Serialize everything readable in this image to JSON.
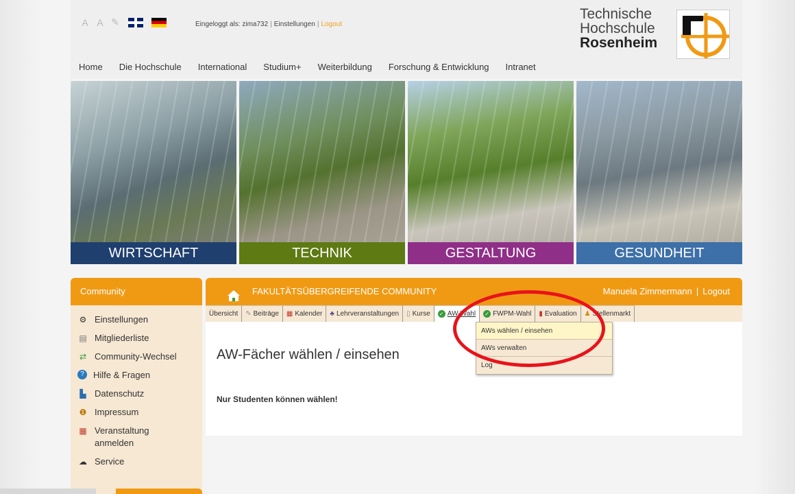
{
  "header": {
    "tool_icons": [
      "zoom-out-icon",
      "zoom-in-icon",
      "pin-icon"
    ],
    "login_prefix": "Eingeloggt als: zima732",
    "settings_link": "Einstellungen",
    "logout_link": "Logout",
    "logo_line1": "Technische",
    "logo_line2": "Hochschule",
    "logo_line3": "Rosenheim",
    "nav": [
      "Home",
      "Die Hochschule",
      "International",
      "Studium+",
      "Weiterbildung",
      "Forschung & Entwicklung",
      "Intranet"
    ]
  },
  "banner": {
    "panels": [
      {
        "label": "WIRTSCHAFT",
        "color": "#1f3f6e"
      },
      {
        "label": "TECHNIK",
        "color": "#5e7a12"
      },
      {
        "label": "GESTALTUNG",
        "color": "#8f2f87"
      },
      {
        "label": "GESUNDHEIT",
        "color": "#3d6fa8"
      }
    ]
  },
  "sidebar": {
    "title": "Community",
    "items": [
      {
        "label": "Einstellungen",
        "icon": "gear-icon"
      },
      {
        "label": "Mitgliederliste",
        "icon": "list-icon"
      },
      {
        "label": "Community-Wechsel",
        "icon": "switch-icon"
      },
      {
        "label": "Hilfe & Fragen",
        "icon": "help-icon"
      },
      {
        "label": "Datenschutz",
        "icon": "privacy-icon"
      },
      {
        "label": "Impressum",
        "icon": "info-icon"
      },
      {
        "label": "Veranstaltung anmelden",
        "icon": "calendar-icon"
      },
      {
        "label": "Service",
        "icon": "service-icon"
      }
    ]
  },
  "content": {
    "community_title": "FAKULTÄTSÜBERGREIFENDE COMMUNITY",
    "user_name": "Manuela Zimmermann",
    "user_logout": "Logout",
    "tabs": [
      {
        "label": "Übersicht",
        "icon": ""
      },
      {
        "label": "Beiträge",
        "icon": "posts-icon"
      },
      {
        "label": "Kalender",
        "icon": "calendar-icon"
      },
      {
        "label": "Lehrveranstaltungen",
        "icon": "courses-icon"
      },
      {
        "label": "Kurse",
        "icon": "course-icon"
      },
      {
        "label": "AW-Wahl",
        "icon": "check-icon"
      },
      {
        "label": "FWPM-Wahl",
        "icon": "check-icon"
      },
      {
        "label": "Evaluation",
        "icon": "evaluation-icon"
      },
      {
        "label": "Stellenmarkt",
        "icon": "jobs-icon"
      }
    ],
    "page_title": "AW-Fächer wählen / einsehen",
    "notice": "Nur Studenten können wählen!"
  },
  "dropdown": {
    "items": [
      "AWs wählen / einsehen",
      "AWs verwalten",
      "Log"
    ]
  },
  "colors": {
    "accent_orange": "#f09a14",
    "sidebar_bg": "#f6e8d3",
    "highlight_red": "#e8131b"
  }
}
